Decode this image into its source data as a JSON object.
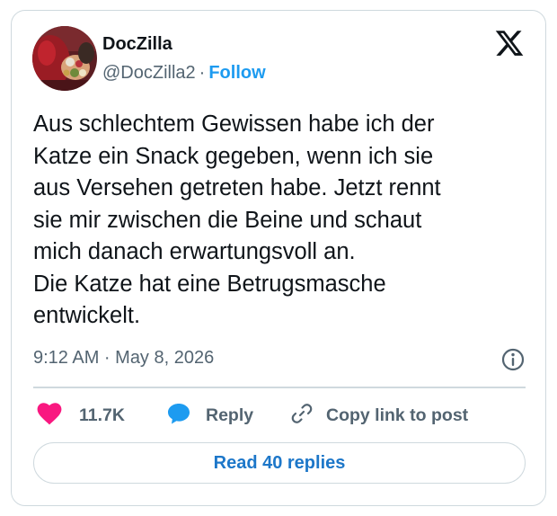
{
  "author": {
    "display_name": "DocZilla",
    "handle": "@DocZilla2",
    "separator": "·",
    "follow_label": "Follow"
  },
  "tweet": {
    "text": "Aus schlechtem Gewissen habe ich der\nKatze ein Snack gegeben, wenn ich sie\naus Versehen getreten habe. Jetzt rennt\nsie mir zwischen die Beine und schaut\nmich danach erwartungsvoll an.\nDie Katze hat eine Betrugsmasche\nentwickelt.",
    "timestamp": "9:12 AM · May 8, 2026"
  },
  "actions": {
    "like_count": "11.7K",
    "reply_label": "Reply",
    "copy_link_label": "Copy link to post"
  },
  "footer": {
    "read_replies_label": "Read 40 replies"
  },
  "colors": {
    "like_heart": "#f91880",
    "reply_bubble": "#1d9bf0",
    "follow_link": "#1d9bf0",
    "read_replies_text": "#1d77c9",
    "border": "#cfd9de",
    "secondary_text": "#536471"
  },
  "icons": {
    "brand": "x-logo-icon",
    "info": "info-icon",
    "like": "heart-icon",
    "reply": "speech-bubble-icon",
    "copy_link": "link-icon"
  }
}
